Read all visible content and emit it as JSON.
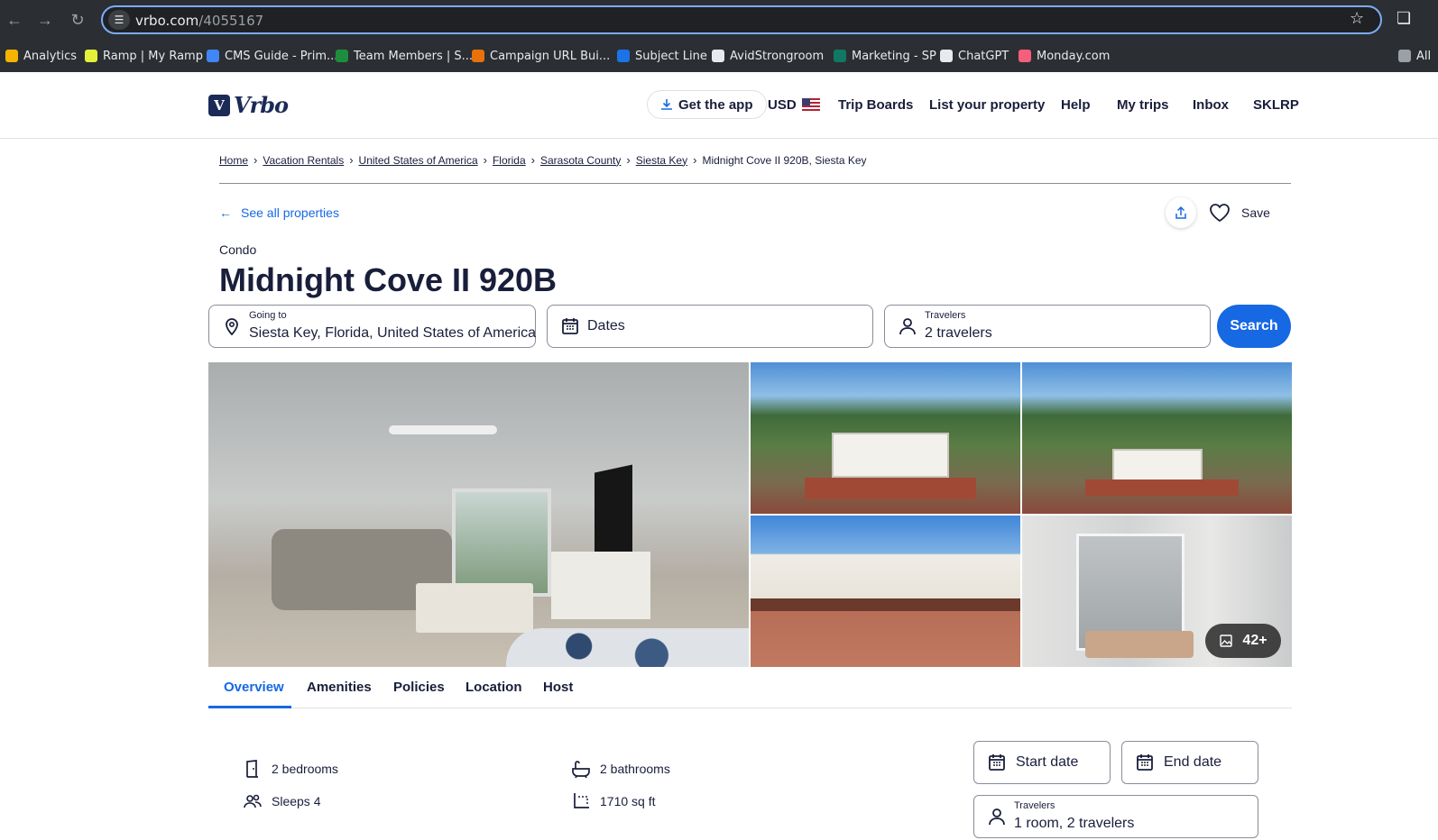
{
  "browser": {
    "url_host": "vrbo.com",
    "url_path": "/4055167",
    "bookmarks": [
      {
        "label": "Analytics",
        "color": "#f4b400"
      },
      {
        "label": "Ramp | My Ramp",
        "color": "#e4f03a"
      },
      {
        "label": "CMS Guide - Prim...",
        "color": "#4285f4"
      },
      {
        "label": "Team Members | S...",
        "color": "#1e8e3e"
      },
      {
        "label": "Campaign URL Bui...",
        "color": "#e8710a"
      },
      {
        "label": "Subject Line",
        "color": "#1a73e8"
      },
      {
        "label": "AvidStrongroom",
        "color": "#e8eaed"
      },
      {
        "label": "Marketing - SP",
        "color": "#117864"
      },
      {
        "label": "ChatGPT",
        "color": "#e8eaed"
      },
      {
        "label": "Monday.com",
        "color": "#f65f7c"
      },
      {
        "label": "All",
        "color": "#9aa0a6"
      }
    ]
  },
  "header": {
    "logo_text": "Vrbo",
    "get_app": "Get the app",
    "currency": "USD",
    "nav": [
      "Trip Boards",
      "List your property",
      "Help",
      "My trips",
      "Inbox",
      "SKLRP"
    ]
  },
  "breadcrumb": {
    "items": [
      "Home",
      "Vacation Rentals",
      "United States of America",
      "Florida",
      "Sarasota County",
      "Siesta Key"
    ],
    "current": "Midnight Cove II 920B, Siesta Key"
  },
  "listing": {
    "see_all": "See all properties",
    "save": "Save",
    "type": "Condo",
    "title": "Midnight Cove II 920B"
  },
  "search": {
    "going_to_label": "Going to",
    "going_to_value": "Siesta Key, Florida, United States of America",
    "dates_placeholder": "Dates",
    "travelers_label": "Travelers",
    "travelers_value": "2 travelers",
    "button": "Search"
  },
  "gallery": {
    "more_count": "42+"
  },
  "tabs": [
    "Overview",
    "Amenities",
    "Policies",
    "Location",
    "Host"
  ],
  "features": {
    "bedrooms": "2 bedrooms",
    "bathrooms": "2 bathrooms",
    "sleeps": "Sleeps 4",
    "sqft": "1710 sq ft"
  },
  "booking": {
    "start_date": "Start date",
    "end_date": "End date",
    "travelers_label": "Travelers",
    "travelers_value": "1 room, 2 travelers"
  },
  "colors": {
    "brand_navy": "#1b2a57",
    "accent_blue": "#1668e3",
    "text": "#191e3b"
  }
}
